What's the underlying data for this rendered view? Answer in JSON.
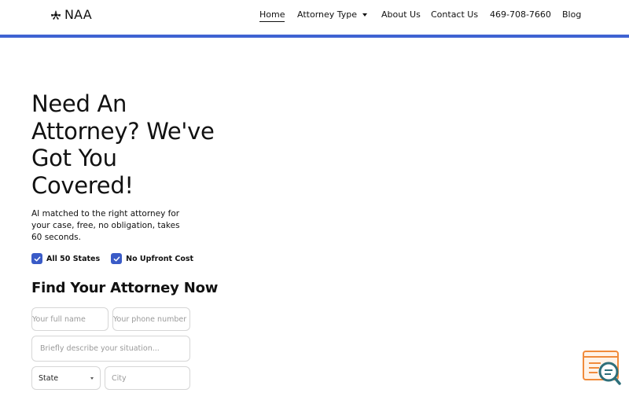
{
  "brand": {
    "name": "NAA",
    "icon": "logo-leaf-icon"
  },
  "nav": {
    "items": [
      {
        "label": "Home",
        "active": true
      },
      {
        "label": "Attorney Type",
        "has_dropdown": true
      },
      {
        "label": "About Us"
      },
      {
        "label": "Contact Us"
      },
      {
        "label": "469-708-7660"
      },
      {
        "label": "Blog"
      }
    ]
  },
  "colors": {
    "accent": "#3f63d2",
    "check": "#3a5bc7",
    "widget_orange": "#f08b3b",
    "widget_teal": "#2e6f7a"
  },
  "hero": {
    "title": "Need An Attorney? We've Got You Covered!",
    "subtitle": "AI matched to the right attorney for your case, free, no obligation, takes 60 seconds.",
    "badges": [
      {
        "label": "All 50 States",
        "icon": "check-icon"
      },
      {
        "label": "No Upfront Cost",
        "icon": "check-icon"
      }
    ]
  },
  "form": {
    "title": "Find Your Attorney Now",
    "name_placeholder": "Your full name",
    "phone_placeholder": "Your phone number",
    "description_placeholder": "Briefly describe your situation...",
    "state_value": "State",
    "city_placeholder": "City"
  },
  "widget": {
    "icon": "search-chat-widget-icon"
  }
}
